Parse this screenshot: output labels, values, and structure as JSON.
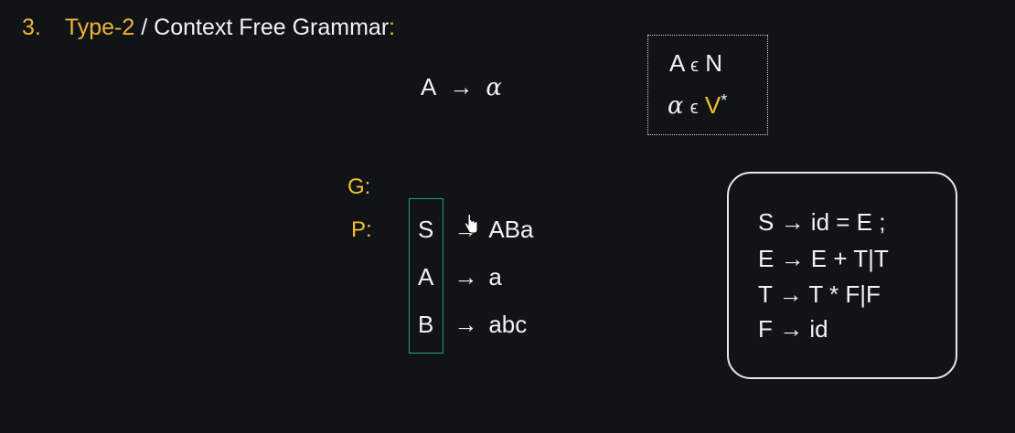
{
  "heading": {
    "number": "3.",
    "type_label": "Type-2",
    "title": " / Context Free Grammar",
    "colon": ":"
  },
  "main_rule": {
    "lhs": "A",
    "arrow": "→",
    "rhs": "α"
  },
  "definitions": {
    "line1": {
      "symbol": "A",
      "op": "ϵ",
      "set": "N"
    },
    "line2": {
      "symbol": "α",
      "op": "ϵ",
      "set": "V",
      "star": "*"
    }
  },
  "grammar": {
    "g_label": "G:",
    "p_label": "P:",
    "productions": [
      {
        "lhs": "S",
        "arrow": "→",
        "rhs": "ABa"
      },
      {
        "lhs": "A",
        "arrow": "→",
        "rhs": "a"
      },
      {
        "lhs": "B",
        "arrow": "→",
        "rhs": "abc"
      }
    ]
  },
  "example_grammar": [
    "S → id = E ;",
    "E → E + T|T",
    "T → T * F|F",
    "F → id"
  ],
  "colors": {
    "background": "#111416",
    "accent_orange": "#f0b23a",
    "accent_yellow": "#f0c030",
    "box_green": "#1fa08a",
    "text": "#f2f2f2"
  }
}
